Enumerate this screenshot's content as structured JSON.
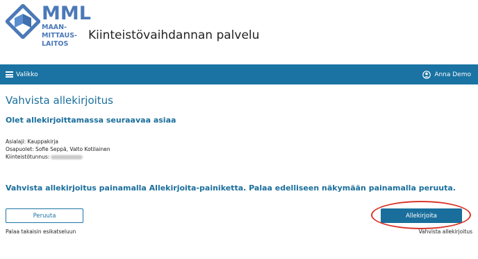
{
  "brand": {
    "logo_main": "MML",
    "logo_lines": [
      "MAAN-",
      "MITTAUS-",
      "LAITOS"
    ],
    "app_title": "Kiinteistövaihdannan palvelu",
    "colors": {
      "primary": "#1a73a3",
      "heading": "#1a6e9c",
      "logo": "#4b79b8",
      "highlight_ring": "#d9352a"
    }
  },
  "navbar": {
    "menu_icon": "hamburger-icon",
    "menu_label": "Valikko",
    "user_icon": "user-circle-icon",
    "user_label": "Anna Demo"
  },
  "main": {
    "page_title": "Vahvista allekirjoitus",
    "section_title": "Olet allekirjoittamassa seuraavaa asiaa",
    "details": {
      "asialaji": "Asialaji: Kauppakirja",
      "osapuolet": "Osapuolet: Sofie Seppä, Valto Kotilainen",
      "kiinteistotunnus": "Kiinteistötunnus:"
    },
    "instruction": "Vahvista allekirjoitus painamalla Allekirjoita-painiketta. Palaa edelliseen näkymään painamalla peruuta.",
    "cancel_button": "Peruuta",
    "cancel_hint": "Palaa takaisin esikatseluun",
    "sign_button": "Allekirjoita",
    "sign_hint": "Vahvista allekirjoitus"
  }
}
